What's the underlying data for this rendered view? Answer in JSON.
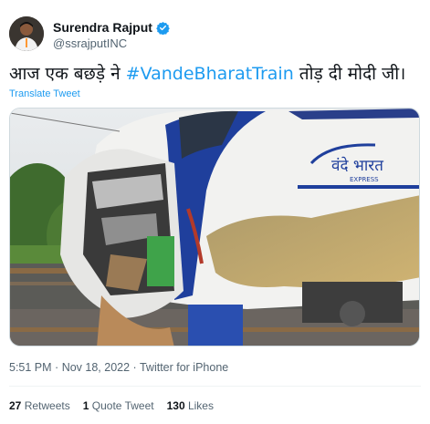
{
  "author": {
    "name": "Surendra Rajput",
    "handle": "@ssrajputINC",
    "verified": true
  },
  "tweet": {
    "text_before": "आज एक बछड़े ने ",
    "hashtag": "#VandeBharatTrain",
    "text_after": " तोड़ दी मोदी जी।",
    "translate_label": "Translate Tweet"
  },
  "media": {
    "description_logo_text": "वंदे भारत",
    "logo_sub": "EXPRESS"
  },
  "meta": {
    "time": "5:51 PM",
    "separator": "·",
    "date": "Nov 18, 2022",
    "source": "Twitter for iPhone"
  },
  "stats": {
    "retweets_count": "27",
    "retweets_label": "Retweets",
    "quotes_count": "1",
    "quotes_label": "Quote Tweet",
    "likes_count": "130",
    "likes_label": "Likes"
  },
  "colors": {
    "link": "#1d9bf0",
    "secondary_text": "#536471",
    "train_blue": "#1f3f9c"
  }
}
